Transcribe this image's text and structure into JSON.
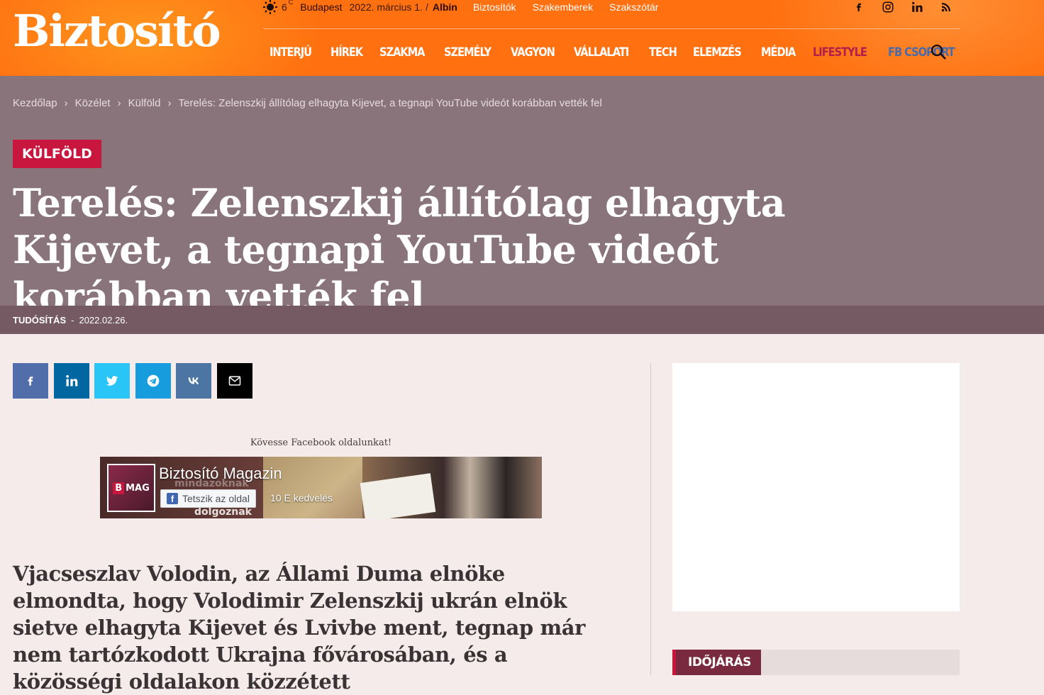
{
  "header": {
    "logo": "Biztosító",
    "weather_temp": "6",
    "weather_unit": "C",
    "city": "Budapest",
    "date": "2022. március 1.",
    "date_sep": "/",
    "nameday": "Albin",
    "top_links": [
      "Biztosítók",
      "Szakemberek",
      "Szakszótár"
    ],
    "social_icons": [
      "facebook-icon",
      "instagram-icon",
      "linkedin-icon",
      "rss-icon"
    ],
    "nav": [
      "INTERJÚ",
      "HÍREK",
      "SZAKMA",
      "SZEMÉLY",
      "VAGYON",
      "VÁLLALATI",
      "TECH",
      "ELEMZÉS",
      "MÉDIA",
      "LIFESTYLE",
      "FB CSOPORT"
    ],
    "colors": {
      "bar": "#ff7010",
      "lifestyle": "#b0204a",
      "fb_csoport": "#4a6aa8"
    }
  },
  "breadcrumb": {
    "items": [
      "Kezdőlap",
      "Közélet",
      "Külföld",
      "Terelés: Zelenszkij állítólag elhagyta Kijevet, a tegnapi YouTube videót korábban vették fel"
    ],
    "separator": "›"
  },
  "article": {
    "category": "KÜLFÖLD",
    "title": "Terelés: Zelenszkij állítólag elhagyta Kijevet, a tegnapi YouTube videót korábban vették fel",
    "type": "TUDÓSÍTÁS",
    "meta_sep": "-",
    "date": "2022.02.26.",
    "lead": "Vjacseszlav Volodin, az Állami Duma elnöke elmondta, hogy Volodimir Zelenszkij ukrán elnök sietve elhagyta Kijevet és Lvivbe ment, tegnap már nem tartózkodott Ukrajna fővárosában, és a közösségi oldalakon közzétett"
  },
  "share": {
    "buttons": [
      {
        "name": "facebook",
        "color": "#516eab"
      },
      {
        "name": "linkedin",
        "color": "#0266a0"
      },
      {
        "name": "twitter",
        "color": "#29c5f6"
      },
      {
        "name": "telegram",
        "color": "#179cde"
      },
      {
        "name": "vk",
        "color": "#4c75a3"
      },
      {
        "name": "email",
        "color": "#000000"
      }
    ]
  },
  "facebook_widget": {
    "caption": "Kövesse Facebook oldalunkat!",
    "page_name": "Biztosító Magazin",
    "avatar_b": "B",
    "avatar_text": "MAG",
    "like_label": "Tetszik az oldal",
    "likes": "10 E kedvelés",
    "banner_word1": "mindazoknak",
    "banner_word2": "dolgoznak"
  },
  "sidebar": {
    "weather_title": "IDŐJÁRÁS"
  }
}
